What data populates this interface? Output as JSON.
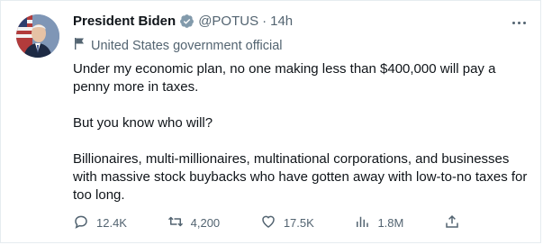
{
  "tweet": {
    "author_name": "President Biden",
    "handle": "@POTUS",
    "separator": "·",
    "time": "14h",
    "label": "United States government official",
    "paragraphs": [
      "Under my economic plan, no one making less than $400,000 will pay a penny more in taxes.",
      "But you know who will?",
      "Billionaires, multi-millionaires, multinational corporations, and businesses with massive stock buybacks who have gotten away with low-to-no taxes for too long."
    ]
  },
  "actions": {
    "replies": "12.4K",
    "retweets": "4,200",
    "likes": "17.5K",
    "views": "1.8M"
  },
  "colors": {
    "text": "#0f1419",
    "secondary": "#536471",
    "verified_gray": "#829aab"
  },
  "icons": [
    "verified-badge-icon",
    "flag-icon",
    "more-icon",
    "reply-icon",
    "retweet-icon",
    "like-icon",
    "views-icon",
    "share-icon"
  ]
}
